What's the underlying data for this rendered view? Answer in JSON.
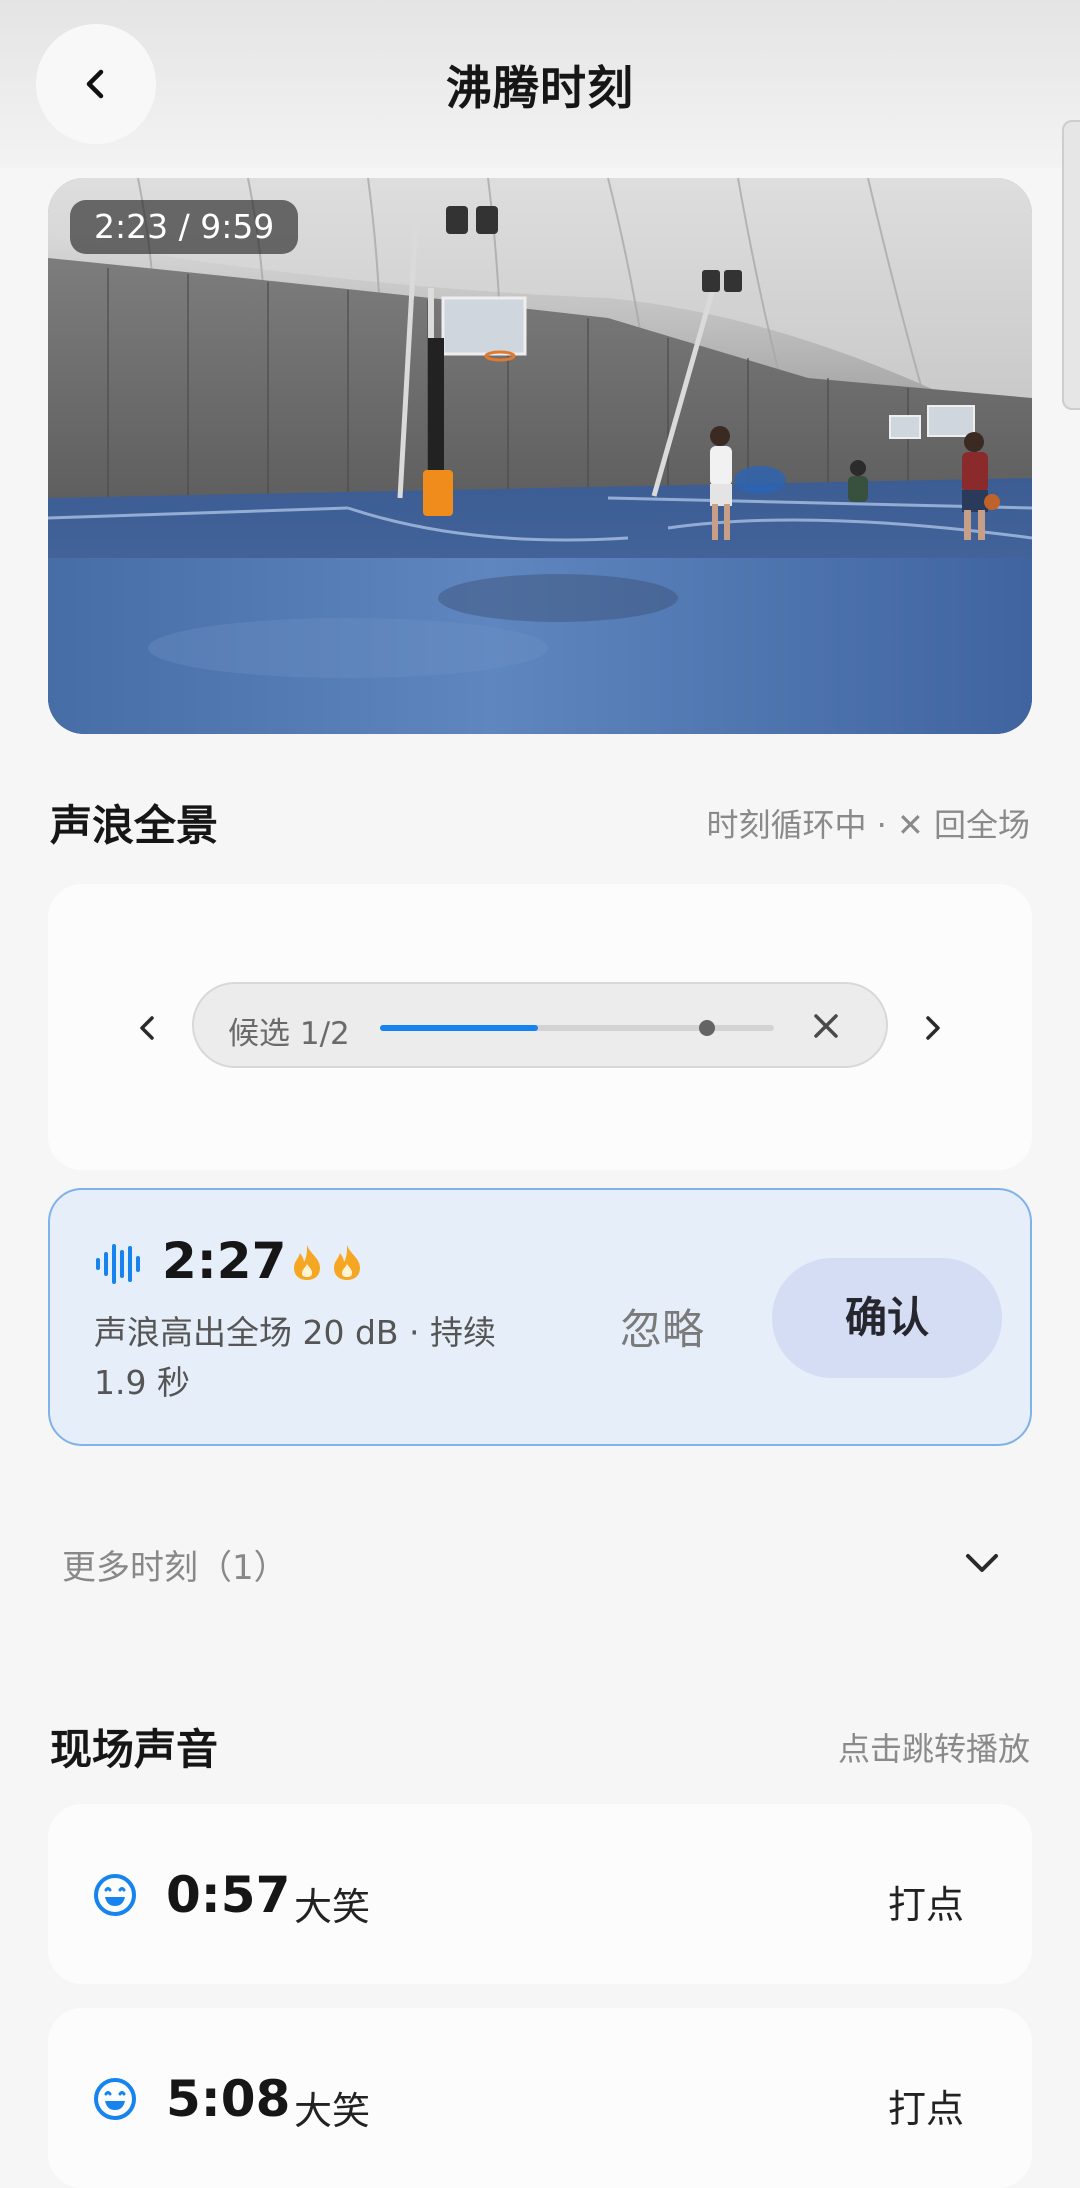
{
  "header": {
    "title": "沸腾时刻",
    "back_icon": "chevron-left-icon"
  },
  "video": {
    "timestamp": "2:23 / 9:59"
  },
  "sound_panorama": {
    "title": "声浪全景",
    "hint": "时刻循环中 · ✕ 回全场",
    "candidate_label": "候选 1/2",
    "progress": 0.4,
    "knob_position": 0.83
  },
  "moment": {
    "time": "2:27",
    "fire_count": 2,
    "description": "声浪高出全场 20 dB · 持续 1.9 秒",
    "ignore_label": "忽略",
    "confirm_label": "确认",
    "accent_color": "#1683ee"
  },
  "more_moments": {
    "label": "更多时刻（1）"
  },
  "live_sound": {
    "title": "现场声音",
    "hint": "点击跳转播放",
    "items": [
      {
        "time": "0:57",
        "label": "大笑",
        "action": "打点"
      },
      {
        "time": "5:08",
        "label": "大笑",
        "action": "打点"
      }
    ]
  }
}
